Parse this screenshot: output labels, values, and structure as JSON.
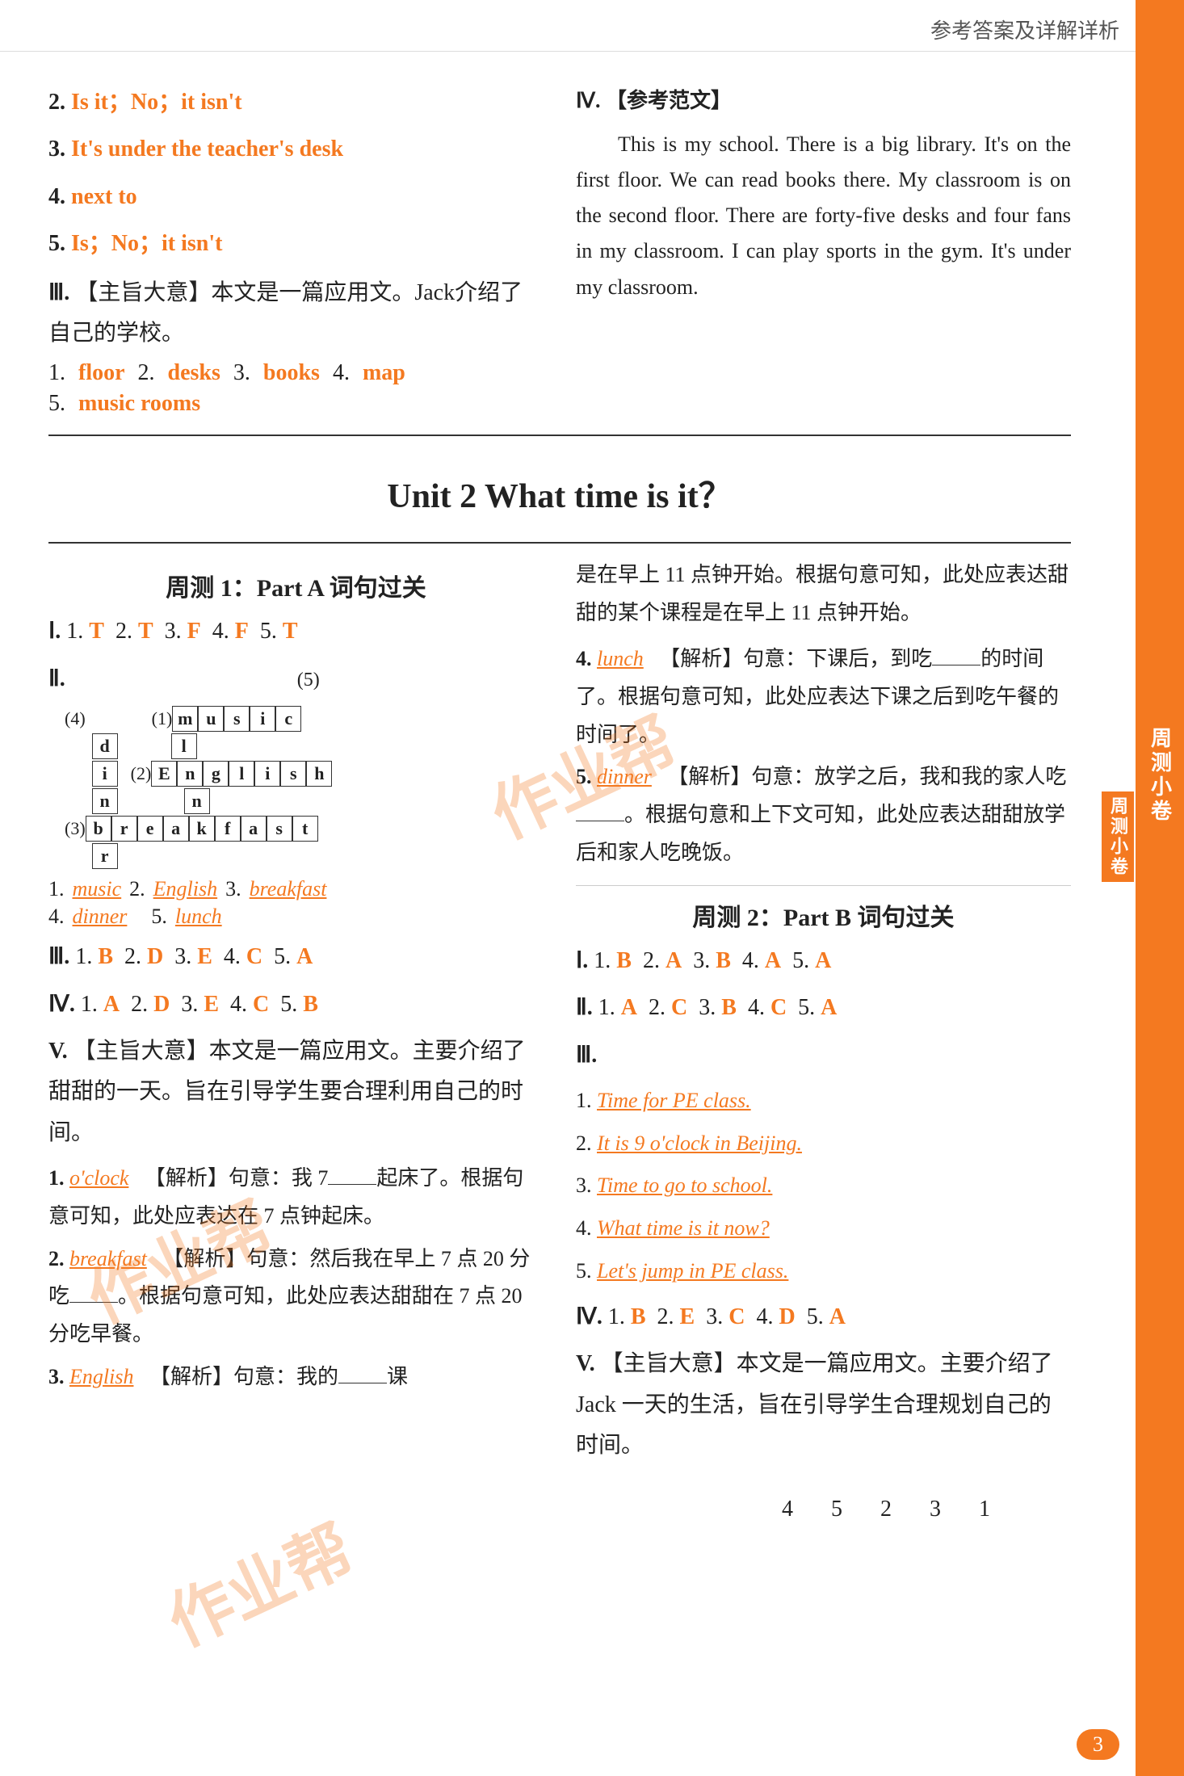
{
  "header": {
    "title": "参考答案及详解详析"
  },
  "top_section": {
    "left_col": {
      "items": [
        {
          "num": "2.",
          "answer": "Is it；No；it isn't"
        },
        {
          "num": "3.",
          "answer": "It's under the teacher's desk"
        },
        {
          "num": "4.",
          "answer": "next to"
        },
        {
          "num": "5.",
          "answer": "Is；No；it isn't"
        }
      ],
      "section3_label": "Ⅲ.",
      "section3_note": "【主旨大意】本文是一篇应用文。Jack介绍了自己的学校。",
      "section3_answers": [
        {
          "num": "1.",
          "word": "floor"
        },
        {
          "num": "2.",
          "word": "desks"
        },
        {
          "num": "3.",
          "word": "books"
        },
        {
          "num": "4.",
          "word": "map"
        }
      ],
      "section3_answer5": {
        "num": "5.",
        "word": "music rooms"
      }
    },
    "right_col": {
      "section4_label": "Ⅳ.",
      "section4_title": "【参考范文】",
      "text": "This is my school. There is a big library. It's on the first floor. We can read books there. My classroom is on the second floor. There are forty-five desks and four fans in my classroom. I can play sports in the gym. It's under my classroom."
    }
  },
  "unit_title": "Unit 2   What time is it？",
  "week1": {
    "title": "周测 1：Part A 词句过关",
    "section1_label": "Ⅰ.",
    "section1_answers": "1. T  2. T  3. F  4. F  5. T",
    "section2_label": "Ⅱ.",
    "crossword": {
      "number5": "(5)",
      "number4": "(4)",
      "number1": "(1)",
      "number2": "(2)",
      "number3": "(3)",
      "word1": "music",
      "word2": "English",
      "word3": "breakfast",
      "word4": "d",
      "word5": "lunch",
      "letters_1": [
        "m",
        "u",
        "s",
        "i",
        "c"
      ],
      "letters_2": [
        "E",
        "n",
        "g",
        "l",
        "i",
        "s",
        "h"
      ],
      "letters_3": [
        "b",
        "r",
        "e",
        "a",
        "k",
        "f",
        "a",
        "s",
        "t"
      ],
      "vertical_lunch": [
        "l",
        "u",
        "n",
        "c",
        "h"
      ],
      "vertical_dinner": [
        "d",
        "i",
        "n",
        "n",
        "e",
        "r"
      ]
    },
    "fill_answers": [
      {
        "num": "1.",
        "word": "music"
      },
      {
        "num": "2.",
        "word": "English"
      },
      {
        "num": "3.",
        "word": "breakfast"
      },
      {
        "num": "4.",
        "word": "dinner"
      },
      {
        "num": "5.",
        "word": "lunch"
      }
    ],
    "section3_label": "Ⅲ.",
    "section3_answers": "1. B  2. D  3. E  4. C  5. A",
    "section4_label": "Ⅳ.",
    "section4_answers": "1. A  2. D  3. E  4. C  5. B",
    "section5_label": "V.",
    "section5_note": "【主旨大意】本文是一篇应用文。主要介绍了甜甜的一天。旨在引导学生要合理利用自己的时间。",
    "explanation1": {
      "num": "1.",
      "word": "o'clock",
      "text": "【解析】句意：我 7        起床了。根据句意可知，此处应表达在 7 点钟起床。"
    },
    "explanation2": {
      "num": "2.",
      "word": "breakfast",
      "text": "【解析】句意：然后我在早上 7 点 20 分吃        。根据句意可知，此处应表达甜甜在 7 点 20 分吃早餐。"
    },
    "explanation3": {
      "num": "3.",
      "word": "English",
      "text": "【解析】句意：我的        课是在早上 11 点钟开始。根据句意可知，此处应表达甜甜的某个课程是在早上 11 点钟开始。"
    }
  },
  "week1_right": {
    "text_top": "是在早上 11 点钟开始。根据句意可知，此处应表达甜甜的某个课程是在早上 11 点钟开始。",
    "explanation4": {
      "num": "4.",
      "word": "lunch",
      "text": "【解析】句意：下课后，到吃        的时间了。根据句意可知，此处应表达下课之后到吃午餐的时间了。"
    },
    "explanation5": {
      "num": "5.",
      "word": "dinner",
      "text": "【解析】句意：放学之后，我和我的家人吃        。根据句意和上下文可知，此处应表达甜甜放学后和家人吃晚饭。"
    },
    "week2_title": "周测 2：Part B 词句过关",
    "w2_sec1_label": "Ⅰ.",
    "w2_sec1_answers": "1. B  2. A  3. B  4. A  5. A",
    "w2_sec2_label": "Ⅱ.",
    "w2_sec2_answers": "1. A  2. C  3. B  4. C  5. A",
    "w2_sec3_label": "Ⅲ.",
    "w2_sec3_items": [
      {
        "num": "1.",
        "text": "Time for PE class."
      },
      {
        "num": "2.",
        "text": "It is 9 o'clock in Beijing."
      },
      {
        "num": "3.",
        "text": "Time to go to school."
      },
      {
        "num": "4.",
        "text": "What time is it now?"
      },
      {
        "num": "5.",
        "text": "Let's jump in PE class."
      }
    ],
    "w2_sec4_label": "Ⅳ.",
    "w2_sec4_answers": "1. B  2. E  3. C  4. D  5. A",
    "w2_sec5_label": "V.",
    "w2_sec5_note": "【主旨大意】本文是一篇应用文。主要介绍了 Jack 一天的生活，旨在引导学生合理规划自己的时间。"
  },
  "bottom_right_numbers": "4  5  2  3  1",
  "page_number": "3",
  "sidebar_label": "周测小卷"
}
